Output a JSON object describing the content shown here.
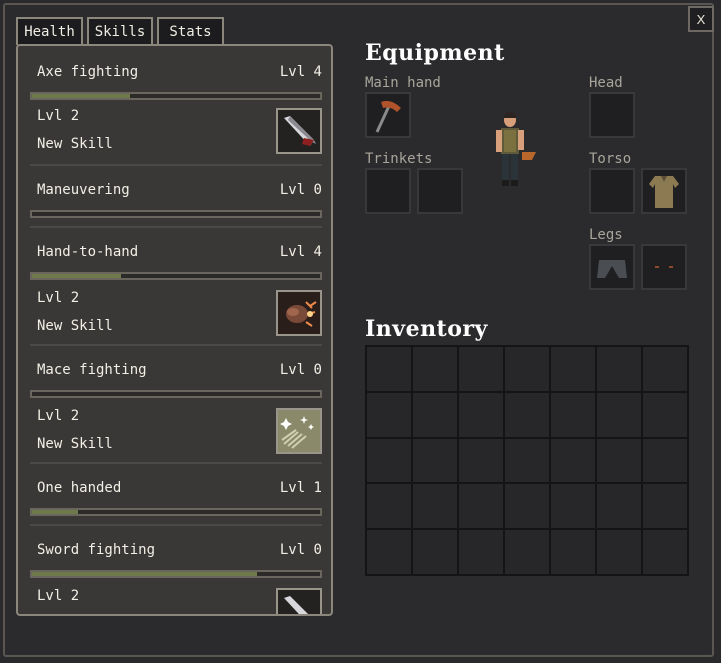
{
  "tabs": [
    {
      "label": "Health"
    },
    {
      "label": "Skills"
    },
    {
      "label": "Stats"
    }
  ],
  "close_label": "X",
  "skills": {
    "axe_fighting": {
      "name": "Axe fighting",
      "level": "Lvl 4",
      "progress": 0.34
    },
    "new_skill_1": {
      "level": "Lvl 2",
      "label": "New Skill",
      "icon": "blade-icon"
    },
    "maneuvering": {
      "name": "Maneuvering",
      "level": "Lvl 0",
      "progress": 0.0
    },
    "hand_to_hand": {
      "name": "Hand-to-hand",
      "level": "Lvl 4",
      "progress": 0.31
    },
    "new_skill_2": {
      "level": "Lvl 2",
      "label": "New Skill",
      "icon": "fist-icon"
    },
    "mace_fighting": {
      "name": "Mace fighting",
      "level": "Lvl 0",
      "progress": 0.0
    },
    "new_skill_3": {
      "level": "Lvl 2",
      "label": "New Skill",
      "icon": "sparkle-icon"
    },
    "one_handed": {
      "name": "One handed",
      "level": "Lvl 1",
      "progress": 0.16
    },
    "sword_fighting": {
      "name": "Sword fighting",
      "level": "Lvl 0",
      "progress": 0.78
    },
    "new_skill_4": {
      "level": "Lvl 2"
    }
  },
  "equipment": {
    "title": "Equipment",
    "main_hand_label": "Main hand",
    "trinkets_label": "Trinkets",
    "head_label": "Head",
    "torso_label": "Torso",
    "legs_label": "Legs"
  },
  "inventory": {
    "title": "Inventory"
  },
  "colors": {
    "bar_fill": "#6f7a4a",
    "panel_border": "#8c877c"
  }
}
